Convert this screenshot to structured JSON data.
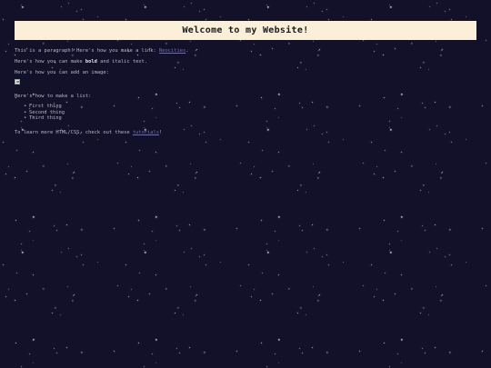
{
  "page": {
    "title": "Welcome to my Website!",
    "paragraph1": {
      "text": "This is a paragraph! Here's how you make a link: ",
      "link_text": "Neocities",
      "after": "."
    },
    "paragraph2": {
      "before": "Here's how you can make ",
      "bold": "bold",
      "after": " and italic text."
    },
    "paragraph3": "Here's how you can add an image:",
    "paragraph4": "Here's how to make a list:",
    "list": [
      "First thing",
      "Second thing",
      "Third thing"
    ],
    "paragraph5": {
      "before": "To learn more HTML/CSS, check out these ",
      "link_text": "tutorials",
      "after": "!"
    }
  },
  "colors": {
    "background": "#13112a",
    "banner": "#fcefd8",
    "text": "#b8b5c8",
    "link": "#6f6bb8"
  }
}
